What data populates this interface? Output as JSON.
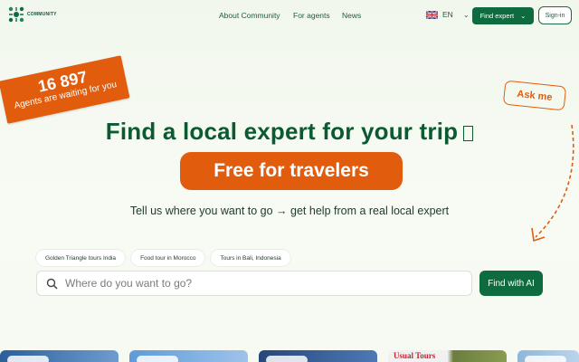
{
  "header": {
    "logo_text": "COMMUNITY",
    "nav": [
      "About Community",
      "For agents",
      "News"
    ],
    "language": "EN",
    "find_expert": "Find expert",
    "sign_in": "Sign-in"
  },
  "badge": {
    "count": "16 897",
    "text": "Agents are waiting for you"
  },
  "ask_me": "Ask me",
  "hero": {
    "title": "Find a local expert for your trip",
    "free_pill": "Free for travelers",
    "subtitle": "Tell us where you want to go → get help from a real local expert"
  },
  "chips": [
    "Golden Triangle tours India",
    "Food tour in Morocco",
    "Tours in Bali, Indonesia"
  ],
  "search": {
    "placeholder": "Where do you want to go?",
    "button": "Find with AI"
  },
  "cards": {
    "card4_brand": "Usual Tours"
  },
  "colors": {
    "brand_green": "#0e6b3f",
    "accent_orange": "#e25c0e",
    "background": "#f2f7ee"
  }
}
